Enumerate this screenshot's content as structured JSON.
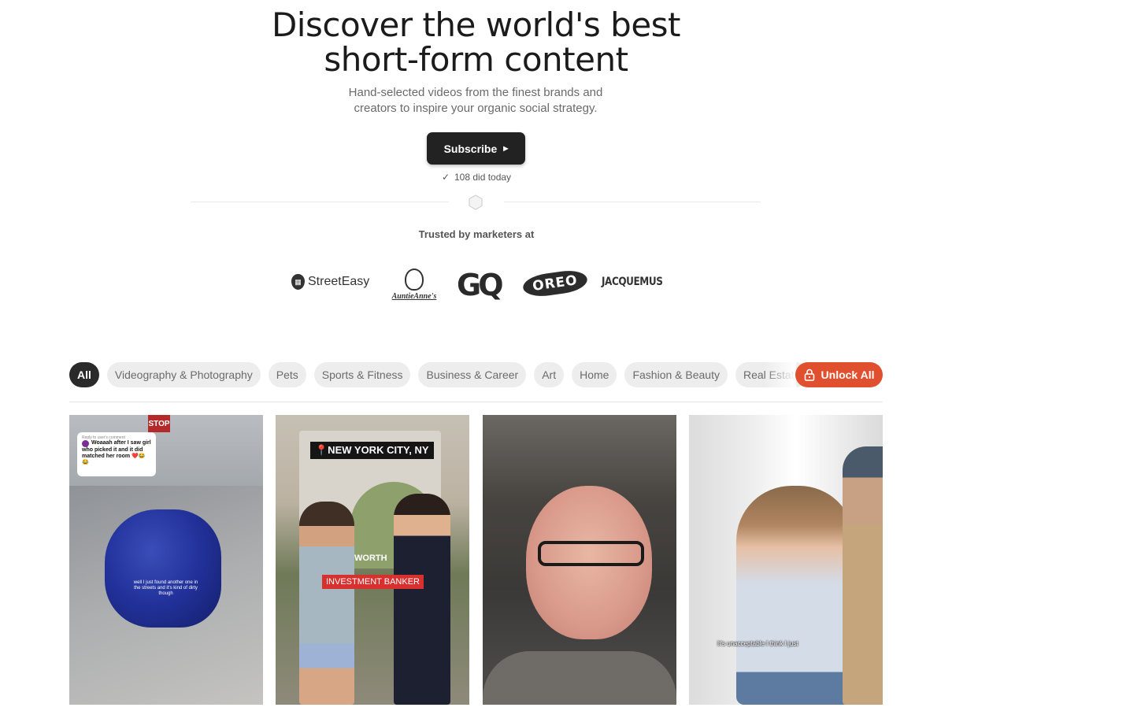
{
  "hero": {
    "title_line1": "Discover the world's best",
    "title_line2": "short-form content",
    "subtitle_line1": "Hand-selected videos from the finest brands and",
    "subtitle_line2": "creators to inspire your organic social strategy.",
    "subscribe_label": "Subscribe",
    "today_count": "108 did today",
    "trusted_label": "Trusted by marketers at"
  },
  "logos": {
    "streeteasy": "StreetEasy",
    "auntie": "AuntieAnne's",
    "gq": "GQ",
    "oreo": "OREO",
    "jacquemus": "JACQUEMUS"
  },
  "filters": {
    "chips": [
      "All",
      "Videography & Photography",
      "Pets",
      "Sports & Fitness",
      "Business & Career",
      "Art",
      "Home",
      "Fashion & Beauty",
      "Real Estate"
    ],
    "active": "All",
    "unlock_label": "Unlock All"
  },
  "cards": [
    {
      "sign": "STOP",
      "reply_note": "Reply to user's comment",
      "comment": "Woaaah after I saw girl who picked it and it did matched her room ❤️😂😂",
      "caption": "well I just found another one in the streets and it's kind of dirty though"
    },
    {
      "location": "📍NEW YORK CITY, NY",
      "overlay_top": "WORTH",
      "overlay_tag": "INVESTMENT BANKER"
    },
    {},
    {
      "caption": "It's unacceptable I think I just"
    }
  ],
  "colors": {
    "accent": "#e0502e",
    "dark_button": "#222222",
    "chip_bg": "#ededed"
  }
}
